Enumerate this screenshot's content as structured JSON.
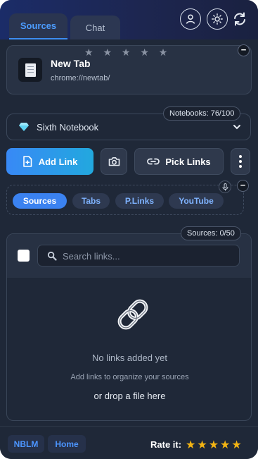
{
  "header": {
    "tabs": [
      {
        "label": "Sources",
        "active": true
      },
      {
        "label": "Chat",
        "active": false
      }
    ],
    "icons": [
      "user-icon",
      "sun-icon",
      "refresh-icon"
    ]
  },
  "current_tab": {
    "title": "New Tab",
    "url": "chrome://newtab/",
    "rating_stars": "★ ★ ★ ★ ★"
  },
  "notebook": {
    "count_label": "Notebooks: 76/100",
    "selected": "Sixth Notebook"
  },
  "actions": {
    "add_link": "Add Link",
    "pick_links": "Pick Links"
  },
  "filters": [
    "Sources",
    "Tabs",
    "P.Links",
    "YouTube"
  ],
  "sources": {
    "count_label": "Sources: 0/50",
    "search_placeholder": "Search links...",
    "empty_title": "No links added yet",
    "empty_subtitle": "Add links to organize your sources",
    "empty_drop": "or drop a file here"
  },
  "footer": {
    "nblm": "NBLM",
    "home": "Home",
    "rate_label": "Rate it:",
    "stars": "★★★★★"
  },
  "colors": {
    "background": "#1f2838",
    "accent": "#3b82f0",
    "star_gold": "#f3b413"
  }
}
